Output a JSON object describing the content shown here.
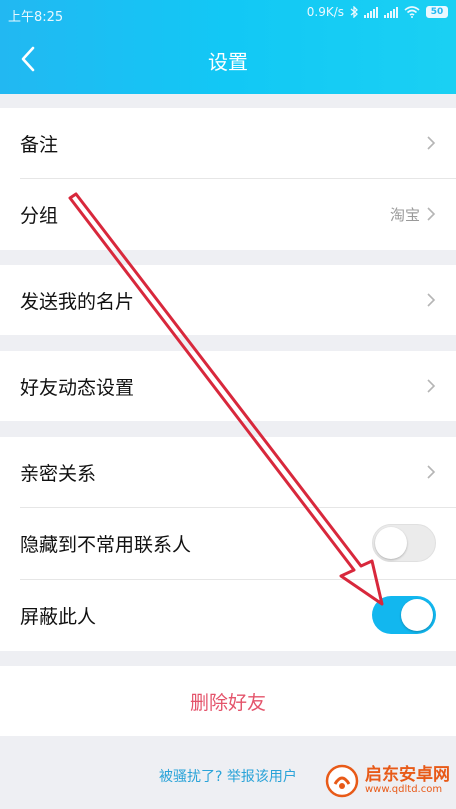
{
  "status_bar": {
    "time": "上午8:25",
    "network_speed": "0.9K/s",
    "battery": "50",
    "icons": [
      "bluetooth-icon",
      "signal-icon",
      "signal-icon",
      "wifi-icon",
      "battery-icon"
    ]
  },
  "header": {
    "title": "设置",
    "back_icon": "chevron-left-icon"
  },
  "settings": {
    "remark": {
      "label": "备注"
    },
    "group": {
      "label": "分组",
      "value": "淘宝"
    },
    "send_card": {
      "label": "发送我的名片"
    },
    "moments_settings": {
      "label": "好友动态设置"
    },
    "relationship": {
      "label": "亲密关系"
    },
    "hide_contact": {
      "label": "隐藏到不常用联系人",
      "enabled": false
    },
    "block_person": {
      "label": "屏蔽此人",
      "enabled": true
    }
  },
  "delete_friend": {
    "label": "删除好友"
  },
  "report": {
    "label": "被骚扰了? 举报该用户"
  },
  "watermark": {
    "title": "启东安卓网",
    "url": "www.qdltd.com"
  },
  "colors": {
    "header": "#1ec3f4",
    "toggle_on": "#12b7ef",
    "delete": "#e4546b",
    "annotation_arrow": "#d8283c"
  }
}
